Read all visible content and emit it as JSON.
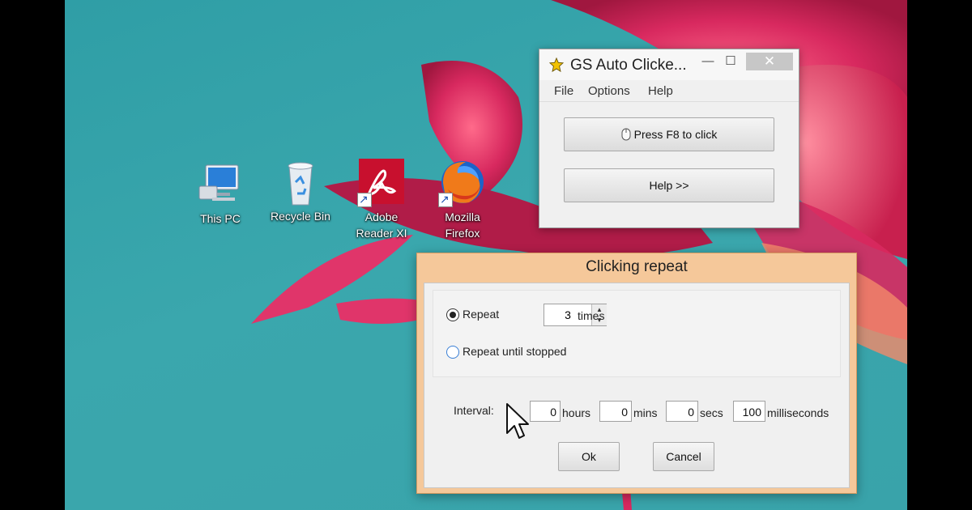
{
  "desktop": {
    "icons": [
      {
        "label_line1": "This PC",
        "label_line2": ""
      },
      {
        "label_line1": "Recycle Bin",
        "label_line2": ""
      },
      {
        "label_line1": "Adobe",
        "label_line2": "Reader XI"
      },
      {
        "label_line1": "Mozilla",
        "label_line2": "Firefox"
      }
    ]
  },
  "gs_window": {
    "title": "GS Auto Clicke...",
    "minimize_glyph": "—",
    "maximize_glyph": "☐",
    "close_glyph": "✕",
    "menu": [
      "File",
      "Options",
      "Help"
    ],
    "click_button_label": "Press F8 to click",
    "help_button_label": "Help >>"
  },
  "clicking_repeat": {
    "title": "Clicking repeat",
    "repeat_label": "Repeat",
    "repeat_value": "3",
    "times_label": "times",
    "repeat_until_label": "Repeat until stopped",
    "repeat_mode": "repeat",
    "interval_label": "Interval:",
    "hours_value": "0",
    "hours_label": "hours",
    "mins_value": "0",
    "mins_label": "mins",
    "secs_value": "0",
    "secs_label": "secs",
    "ms_value": "100",
    "ms_label": "milliseconds",
    "ok_label": "Ok",
    "cancel_label": "Cancel"
  },
  "icons": {
    "window_icon": "star-icon",
    "click_button_icon": "mouse-icon",
    "pointer": "cursor-icon"
  },
  "colors": {
    "desktop_teal": "#39a3aa",
    "flower_pink": "#e0356a",
    "dialog_frame": "#f5c89a",
    "close_button": "#c7c7c7"
  }
}
